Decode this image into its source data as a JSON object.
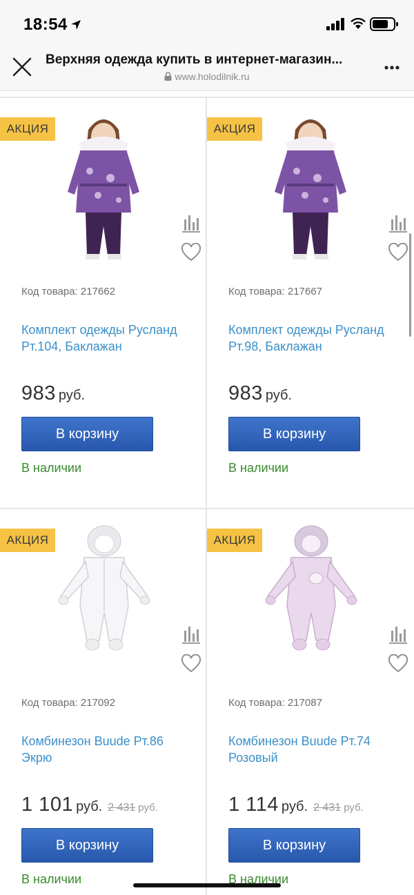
{
  "status_bar": {
    "time": "18:54"
  },
  "browser": {
    "title": "Верхняя одежда купить в интернет-магазин...",
    "url": "www.holodilnik.ru"
  },
  "products": [
    {
      "badge": "АКЦИЯ",
      "sku": "Код товара: 217662",
      "name": "Комплект одежды Русланд Рт.104, Баклажан",
      "price": "983",
      "currency": "руб.",
      "old_price": "",
      "old_currency": "",
      "button": "В корзину",
      "stock": "В наличии"
    },
    {
      "badge": "АКЦИЯ",
      "sku": "Код товара: 217667",
      "name": "Комплект одежды Русланд Рт.98, Баклажан",
      "price": "983",
      "currency": "руб.",
      "old_price": "",
      "old_currency": "",
      "button": "В корзину",
      "stock": "В наличии"
    },
    {
      "badge": "АКЦИЯ",
      "sku": "Код товара: 217092",
      "name": "Комбинезон Buude Рт.86 Экрю",
      "price": "1 101",
      "currency": "руб.",
      "old_price": "2 431",
      "old_currency": "руб.",
      "button": "В корзину",
      "stock": "В наличии"
    },
    {
      "badge": "АКЦИЯ",
      "sku": "Код товара: 217087",
      "name": "Комбинезон Buude Рт.74 Розовый",
      "price": "1 114",
      "currency": "руб.",
      "old_price": "2 431",
      "old_currency": "руб.",
      "button": "В корзину",
      "stock": "В наличии"
    }
  ],
  "icons": {
    "close": "close-icon",
    "more": "more-icon",
    "lock": "lock-icon",
    "compare": "compare-icon",
    "favorite": "heart-icon"
  },
  "colors": {
    "badge": "#f5c244",
    "link": "#3b8fc9",
    "button": "#2f63b8",
    "in_stock": "#3a8a2e"
  }
}
